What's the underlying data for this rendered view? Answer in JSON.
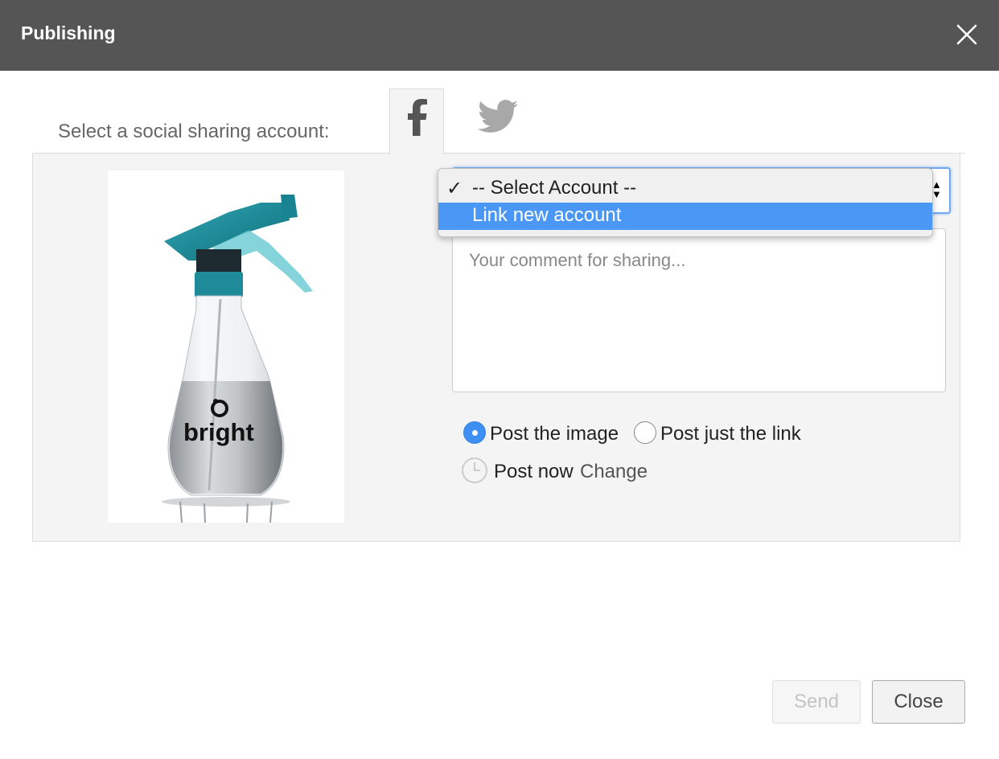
{
  "dialog": {
    "title": "Publishing"
  },
  "sharing": {
    "label": "Select a social sharing account:",
    "tabs": [
      {
        "name": "facebook",
        "icon": "facebook-icon",
        "active": true
      },
      {
        "name": "twitter",
        "icon": "twitter-icon",
        "active": false
      }
    ]
  },
  "preview": {
    "brand_text": "bright"
  },
  "account_select": {
    "options": [
      {
        "label": "-- Select Account --",
        "checked": true,
        "highlighted": false
      },
      {
        "label": "Link new account",
        "checked": false,
        "highlighted": true
      }
    ]
  },
  "comment": {
    "value": "",
    "placeholder": "Your comment for sharing..."
  },
  "post_type": {
    "options": [
      {
        "label": "Post the image",
        "selected": true
      },
      {
        "label": "Post just the link",
        "selected": false
      }
    ]
  },
  "schedule": {
    "status": "Post now",
    "change_label": "Change"
  },
  "buttons": {
    "send_label": "Send",
    "close_label": "Close"
  },
  "colors": {
    "titlebar": "#555555",
    "accent": "#4a97f5",
    "panel": "#f4f4f4"
  }
}
